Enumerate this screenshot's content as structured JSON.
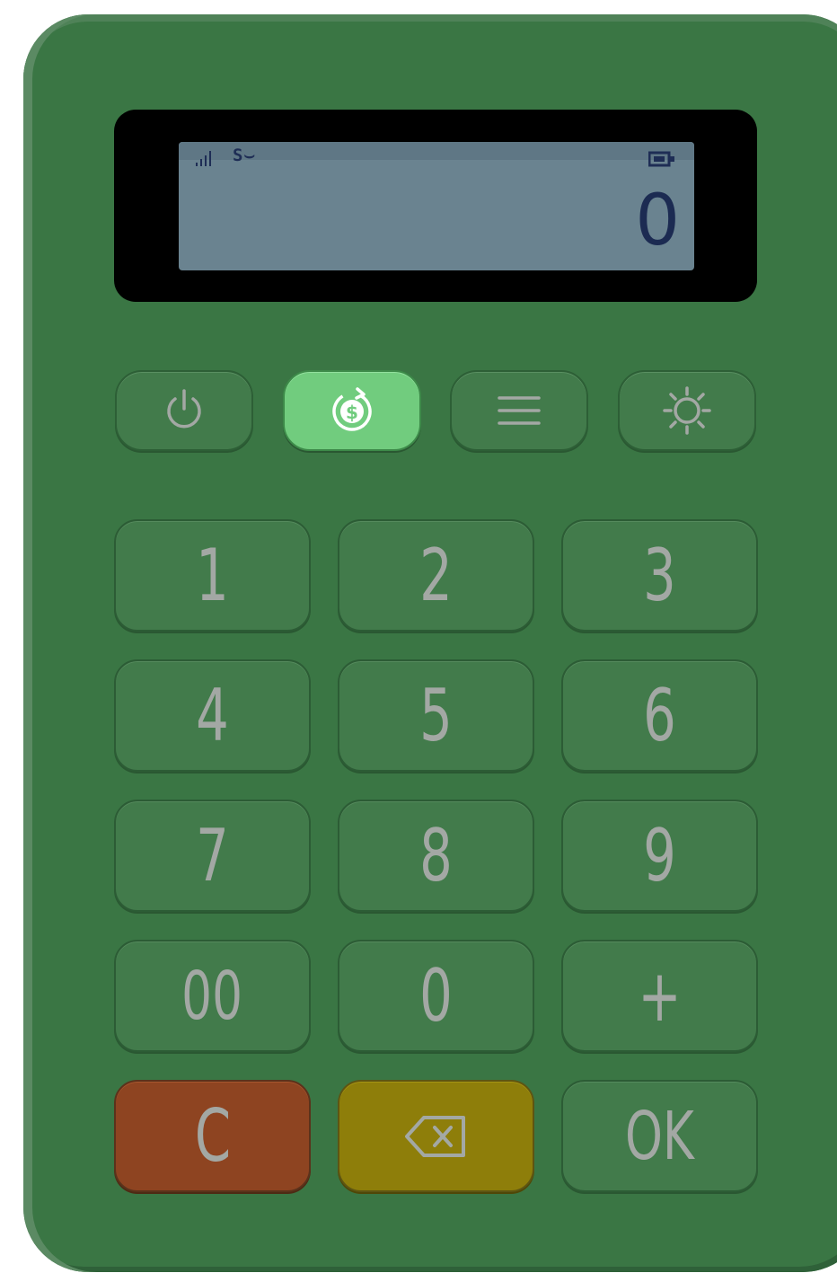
{
  "display": {
    "status_text": "S⌣",
    "amount": "0",
    "signal_icon": "signal-bars-icon",
    "battery_icon": "battery-icon"
  },
  "function_buttons": [
    {
      "name": "power-button",
      "icon": "power-icon"
    },
    {
      "name": "payment-button",
      "icon": "dollar-refresh-icon",
      "active": true
    },
    {
      "name": "menu-button",
      "icon": "hamburger-menu-icon"
    },
    {
      "name": "settings-button",
      "icon": "gear-icon"
    }
  ],
  "keypad": {
    "k1": "1",
    "k2": "2",
    "k3": "3",
    "k4": "4",
    "k5": "5",
    "k6": "6",
    "k7": "7",
    "k8": "8",
    "k9": "9",
    "k00": "00",
    "k0": "0",
    "kplus": "+",
    "kclear": "C",
    "kbackspace_icon": "backspace-icon",
    "kok": "OK"
  },
  "colors": {
    "body": "#3a7644",
    "key": "#427b4b",
    "key_text": "#a3a8a4",
    "active_button": "#71cc7e",
    "clear_key": "#8e4421",
    "backspace_key": "#8e7e0a",
    "lcd": "#6a8390",
    "lcd_text": "#1c2b52"
  }
}
